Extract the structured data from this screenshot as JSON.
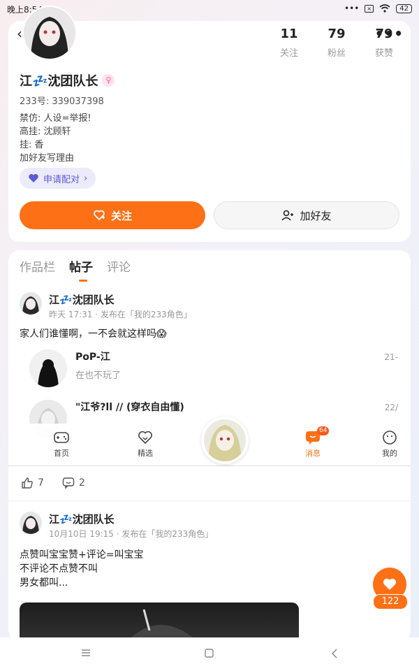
{
  "status": {
    "time": "晚上8:54",
    "dots": "•••",
    "battery": "42"
  },
  "profile": {
    "back_glyph": "‹",
    "more_glyph": "•••",
    "nickname": "江💤沈团队长",
    "gender_glyph": "♀",
    "uid": "233号: 339037398",
    "bio": [
      "禁仿: 人设=举报!",
      "高挂: 沈顾轩",
      "挂: 香",
      "加好友写理由"
    ],
    "stats": [
      {
        "num": "11",
        "label": "关注"
      },
      {
        "num": "79",
        "label": "粉丝"
      },
      {
        "num": "79",
        "label": "获赞"
      }
    ],
    "pair_label": "申请配对",
    "follow_label": "关注",
    "add_friend_label": "加好友"
  },
  "tabs": [
    "作品栏",
    "帖子",
    "评论"
  ],
  "active_tab": 1,
  "posts": [
    {
      "author": "江💤沈团队长",
      "meta": "昨天 17:31 · 发布在「我的233角色」",
      "text": [
        "家人们谁懂啊，一不会就这样吗😱"
      ],
      "likes": "7",
      "comments": "2"
    },
    {
      "author": "江💤沈团队长",
      "meta": "10月10日 19:15 · 发布在「我的233角色」",
      "text": [
        "点赞叫宝宝赞+评论=叫宝宝",
        "不评论不点赞不叫",
        "男女都叫..."
      ]
    }
  ],
  "embedded_comments": [
    {
      "name": "PoP-江",
      "text": "在也不玩了",
      "date": "21-"
    },
    {
      "name": "\"江爷?ll // (穿衣自由懂)",
      "text": "",
      "date": "22/"
    }
  ],
  "nav": {
    "home": "首页",
    "featured": "精选",
    "messages": "消息",
    "messages_badge": "64",
    "mine": "我的"
  },
  "float_like_count": "122",
  "colors": {
    "accent": "#fd7016",
    "pair": "#5d5bd4"
  }
}
